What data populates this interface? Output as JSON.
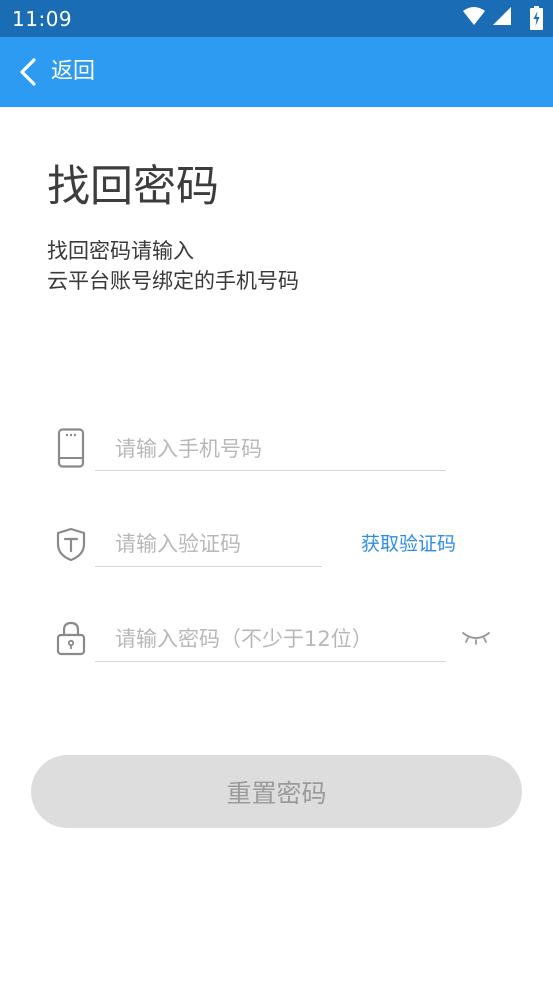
{
  "status_bar": {
    "time": "11:09",
    "icons": [
      "wifi-icon",
      "cellular-signal-icon",
      "battery-charging-icon"
    ]
  },
  "app_bar": {
    "back_label": "返回",
    "background_color": "#2e9bf2"
  },
  "page": {
    "title": "找回密码",
    "subtitle_line1": "找回密码请输入",
    "subtitle_line2": "云平台账号绑定的手机号码"
  },
  "form": {
    "phone_placeholder": "请输入手机号码",
    "code_placeholder": "请输入验证码",
    "get_code_label": "获取验证码",
    "password_placeholder": "请输入密码（不少于12位）"
  },
  "reset_button": {
    "label": "重置密码"
  },
  "colors": {
    "status_bar": "#1a6db5",
    "accent_link": "#2d8ee8",
    "button_disabled_bg": "#dddddd",
    "button_disabled_text": "#9a9a9a"
  }
}
